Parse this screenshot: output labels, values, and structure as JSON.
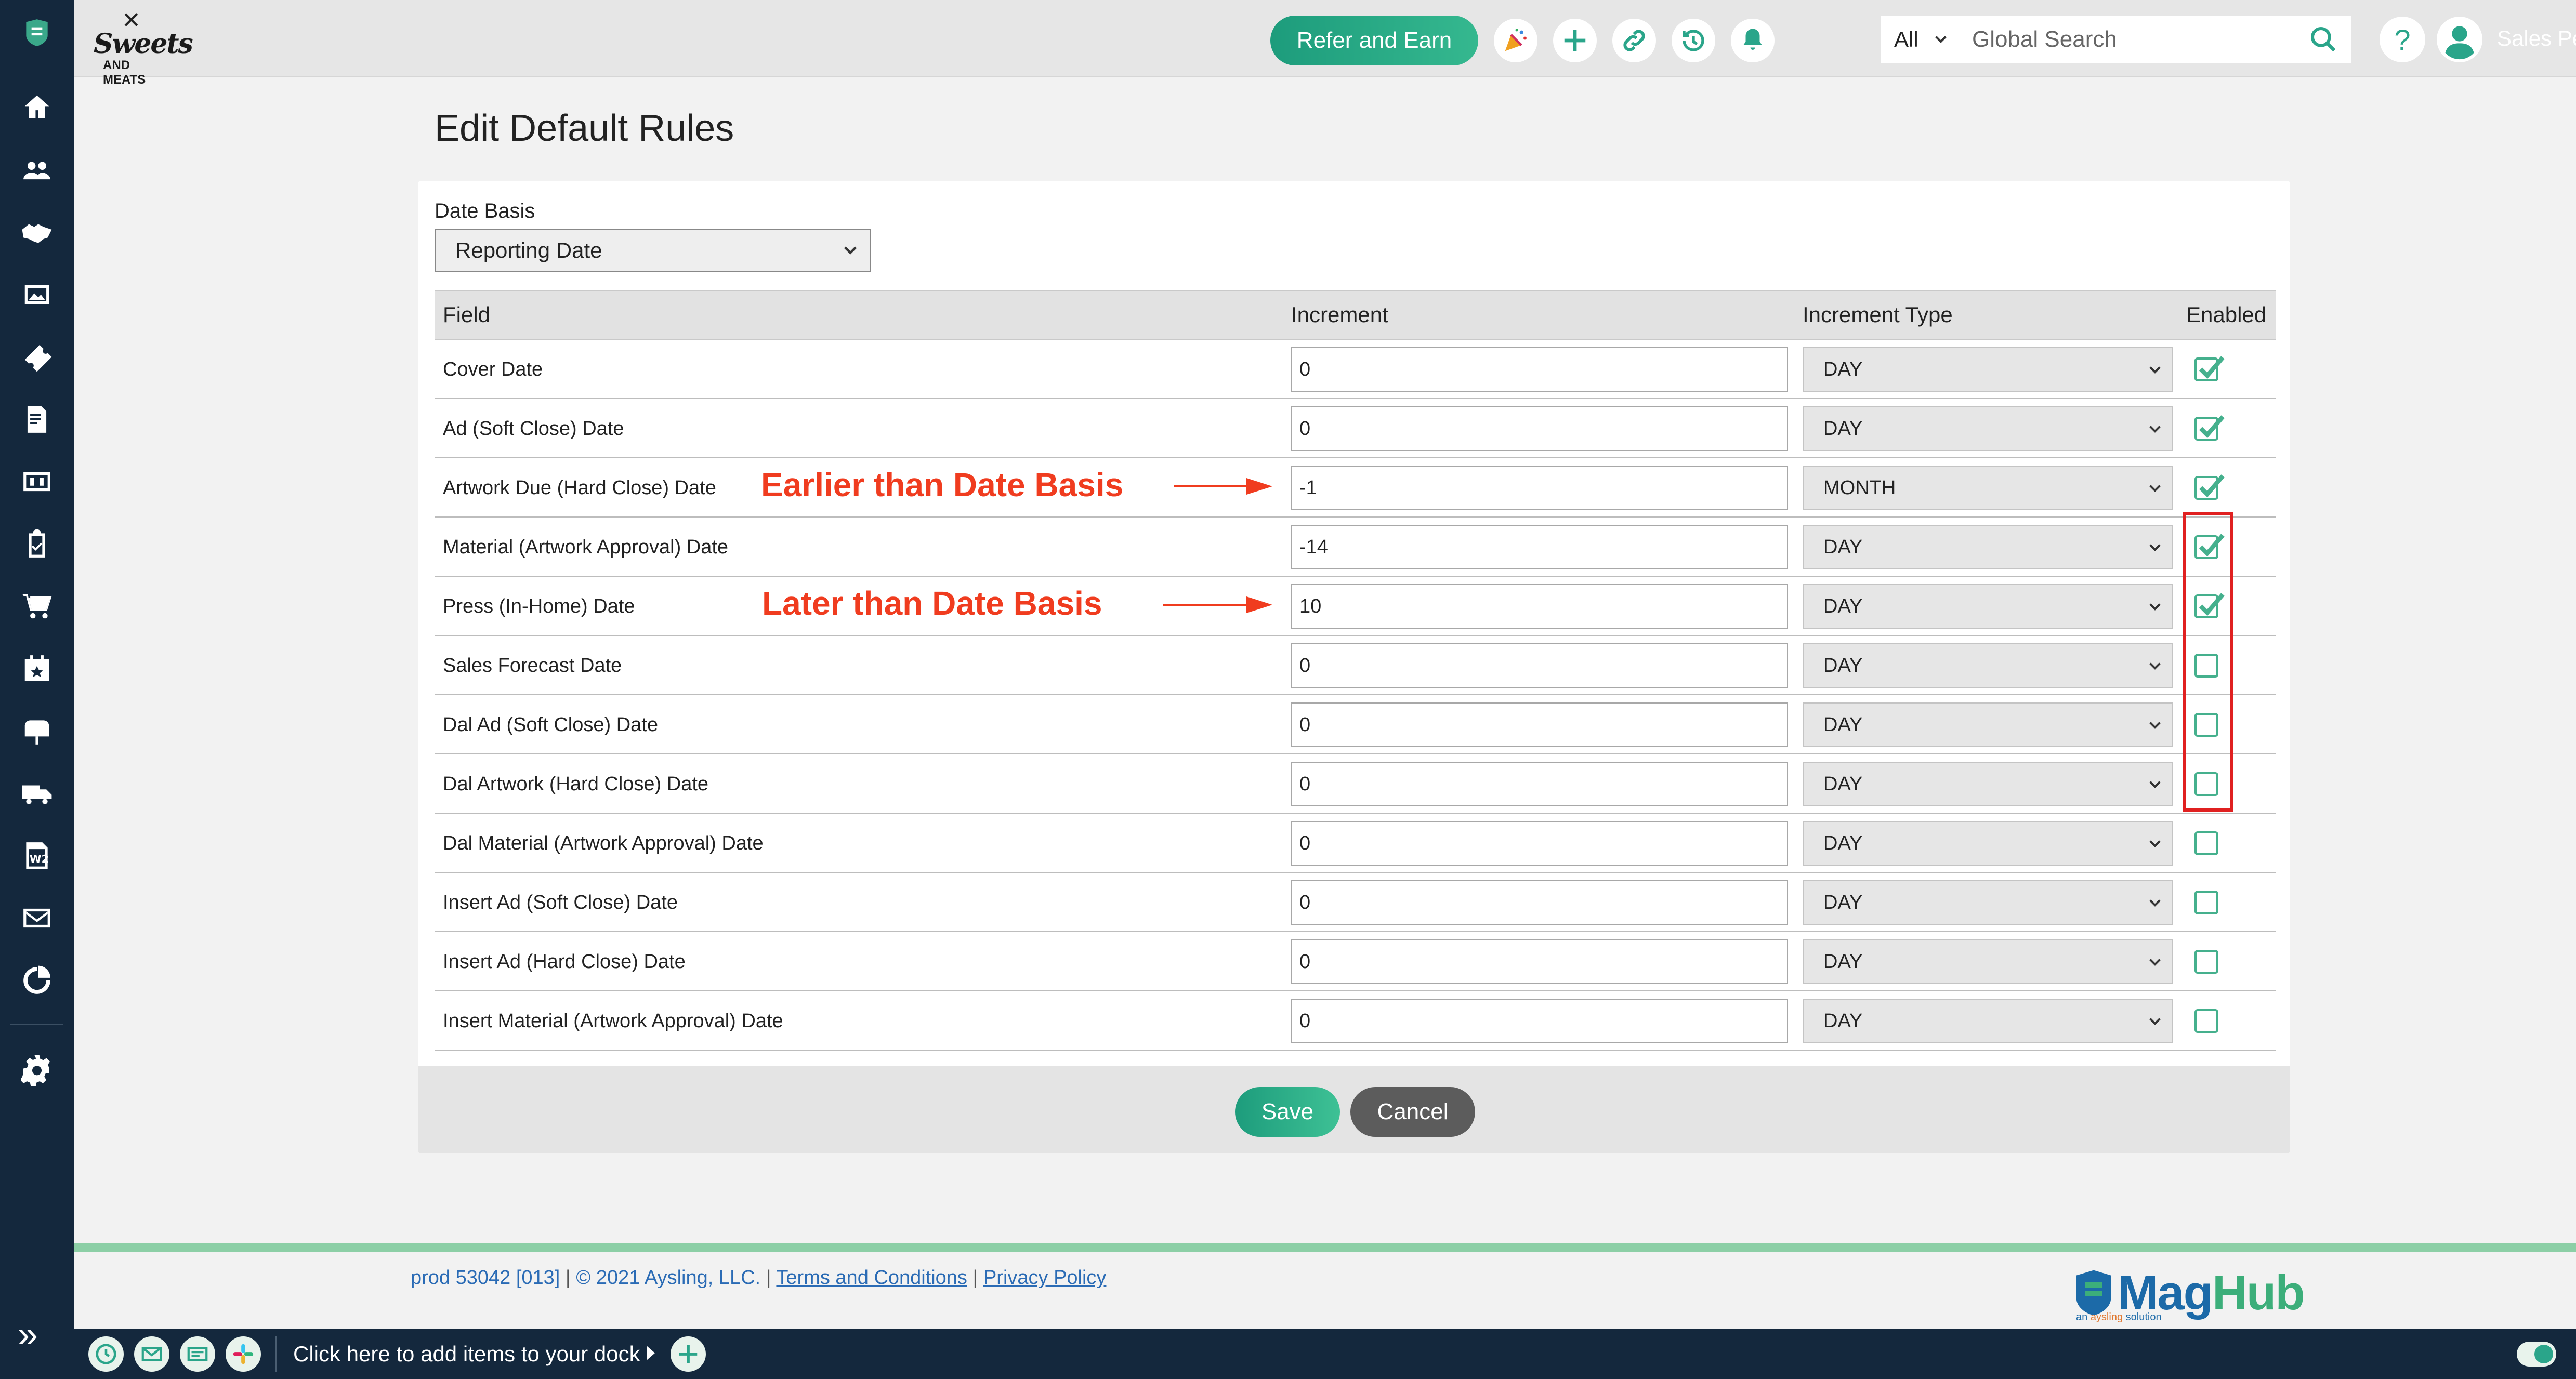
{
  "header": {
    "logo_text": "Sweets",
    "logo_sub": "AND MEATS",
    "refer_label": "Refer and Earn",
    "search_scope": "All",
    "search_placeholder": "Global Search",
    "help_label": "?",
    "user_name": "Sales Person"
  },
  "page": {
    "title": "Edit Default Rules",
    "date_basis_label": "Date Basis",
    "date_basis_value": "Reporting Date"
  },
  "table": {
    "headers": {
      "field": "Field",
      "increment": "Increment",
      "increment_type": "Increment Type",
      "enabled": "Enabled"
    },
    "rows": [
      {
        "field": "Cover Date",
        "increment": "0",
        "type": "DAY",
        "enabled": true
      },
      {
        "field": "Ad (Soft Close) Date",
        "increment": "0",
        "type": "DAY",
        "enabled": true
      },
      {
        "field": "Artwork Due (Hard Close) Date",
        "increment": "-1",
        "type": "MONTH",
        "enabled": true
      },
      {
        "field": "Material (Artwork Approval) Date",
        "increment": "-14",
        "type": "DAY",
        "enabled": true
      },
      {
        "field": "Press (In-Home) Date",
        "increment": "10",
        "type": "DAY",
        "enabled": true
      },
      {
        "field": "Sales Forecast Date",
        "increment": "0",
        "type": "DAY",
        "enabled": false
      },
      {
        "field": "Dal Ad (Soft Close) Date",
        "increment": "0",
        "type": "DAY",
        "enabled": false
      },
      {
        "field": "Dal Artwork (Hard Close) Date",
        "increment": "0",
        "type": "DAY",
        "enabled": false
      },
      {
        "field": "Dal Material (Artwork Approval) Date",
        "increment": "0",
        "type": "DAY",
        "enabled": false
      },
      {
        "field": "Insert Ad (Soft Close) Date",
        "increment": "0",
        "type": "DAY",
        "enabled": false
      },
      {
        "field": "Insert Ad (Hard Close) Date",
        "increment": "0",
        "type": "DAY",
        "enabled": false
      },
      {
        "field": "Insert Material (Artwork Approval) Date",
        "increment": "0",
        "type": "DAY",
        "enabled": false
      }
    ]
  },
  "annotations": {
    "earlier": "Earlier than Date Basis",
    "later": "Later than Date Basis"
  },
  "buttons": {
    "save": "Save",
    "cancel": "Cancel"
  },
  "footer": {
    "build": "prod 53042 [013]",
    "copyright": "© 2021 Aysling, LLC.",
    "terms": "Terms and Conditions",
    "privacy": "Privacy Policy",
    "brand_mag": "Mag",
    "brand_hub": "Hub",
    "brand_sub_pre": "an ",
    "brand_sub_name": "aysling",
    "brand_sub_post": " solution"
  },
  "dock": {
    "prompt": "Click here to add items to your dock"
  },
  "colors": {
    "sidebar": "#14283d",
    "accent_green": "#2aa58a",
    "annotation_red": "#f03c1f",
    "link_blue": "#2a6bb5"
  },
  "sidebar_icons": [
    "maghub-logo-icon",
    "home-icon",
    "contacts-icon",
    "handshake-icon",
    "gallery-icon",
    "ticket-icon",
    "invoice-icon",
    "finance-icon",
    "clipboard-icon",
    "cart-icon",
    "calendar-icon",
    "mailbox-icon",
    "truck-icon",
    "w2-icon",
    "mail-icon",
    "report-icon",
    "settings-icon"
  ]
}
